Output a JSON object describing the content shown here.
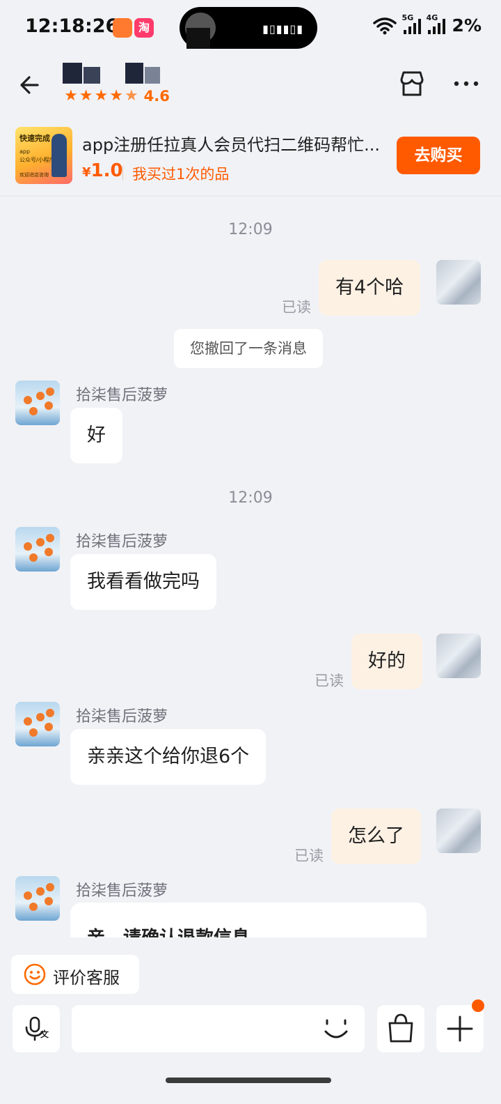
{
  "status_bar": {
    "time": "12:18:26",
    "app_icon_taobao": "淘",
    "network_5g": "5G",
    "network_4g": "4G",
    "battery": "2%"
  },
  "header": {
    "shop_score": "4.6",
    "stars": 5,
    "icons": [
      "back-icon",
      "shop-icon",
      "more-icon"
    ]
  },
  "product": {
    "thumb_title": "快速完成",
    "thumb_sub_1": "app",
    "thumb_sub_2": "公众号/小程序",
    "thumb_footer": "欢迎进店咨询",
    "title": "app注册任拉真人会员代扫二维码帮忙...",
    "currency": "¥",
    "price": "1.0",
    "purchase_note": "我买过1次的品",
    "buy_label": "去购买"
  },
  "chat": {
    "messages": [
      {
        "type": "time",
        "text": "12:09"
      },
      {
        "type": "out",
        "text": "有4个哈",
        "status": "已读"
      },
      {
        "type": "system",
        "text": "您撤回了一条消息"
      },
      {
        "type": "in",
        "sender": "拾柒售后菠萝",
        "text": "好"
      },
      {
        "type": "time",
        "text": "12:09"
      },
      {
        "type": "in",
        "sender": "拾柒售后菠萝",
        "text": "我看看做完吗"
      },
      {
        "type": "out",
        "text": "好的",
        "status": "已读"
      },
      {
        "type": "in",
        "sender": "拾柒售后菠萝",
        "text": "亲亲这个给你退6个"
      },
      {
        "type": "out",
        "text": "怎么了",
        "status": "已读"
      },
      {
        "type": "in-card",
        "sender": "拾柒售后菠萝",
        "text": "亲，请确认退款信息"
      }
    ]
  },
  "bottom": {
    "rate_service": "评价客服",
    "input_placeholder": "",
    "icons": [
      "voice-input-icon",
      "emoji-icon",
      "shopping-bag-icon",
      "plus-icon"
    ]
  },
  "colors": {
    "accent": "#ff5a00",
    "background": "#f1f2f6",
    "outgoing_bubble": "#fdf1e4",
    "incoming_bubble": "#ffffff"
  }
}
